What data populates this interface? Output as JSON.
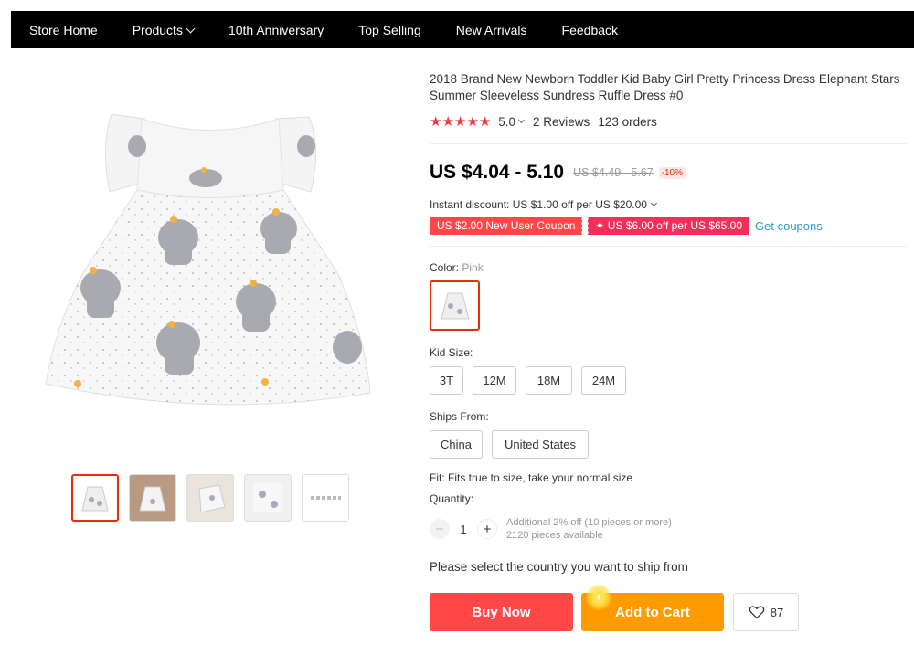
{
  "nav": {
    "items": [
      "Store Home",
      "Products",
      "10th Anniversary",
      "Top Selling",
      "New Arrivals",
      "Feedback"
    ]
  },
  "product": {
    "title": "2018 Brand New Newborn Toddler Kid Baby Girl Pretty Princess Dress Elephant Stars Summer Sleeveless Sundress Ruffle Dress #0",
    "stars": "★★★★★",
    "rating": "5.0",
    "reviews": "2 Reviews",
    "orders": "123 orders",
    "price": "US $4.04 - 5.10",
    "original_price": "US $4.49 - 5.67",
    "discount": "-10%",
    "instant_discount": "Instant discount: US $1.00 off per US $20.00",
    "coupons": [
      "US $2.00 New User Coupon",
      "✦ US $6.00 off per US $65.00"
    ],
    "get_coupons": "Get coupons",
    "color_label": "Color:",
    "color_value": "Pink",
    "kid_size_label": "Kid Size:",
    "sizes": [
      "3T",
      "12M",
      "18M",
      "24M"
    ],
    "ships_from_label": "Ships From:",
    "ships_from": [
      "China",
      "United States"
    ],
    "fit": "Fit: Fits true to size, take your normal size",
    "quantity_label": "Quantity:",
    "quantity": "1",
    "qty_note_1": "Additional 2% off (10 pieces or more)",
    "qty_note_2": "2120 pieces available",
    "ship_prompt": "Please select the country you want to ship from",
    "buy_now": "Buy Now",
    "add_to_cart": "Add to Cart",
    "wishlist_count": "87"
  },
  "colors": {
    "accent_red": "#ff4747",
    "cart_orange": "#ff9a00",
    "star_red": "#f0383f",
    "link_blue": "#2e9cc3"
  }
}
